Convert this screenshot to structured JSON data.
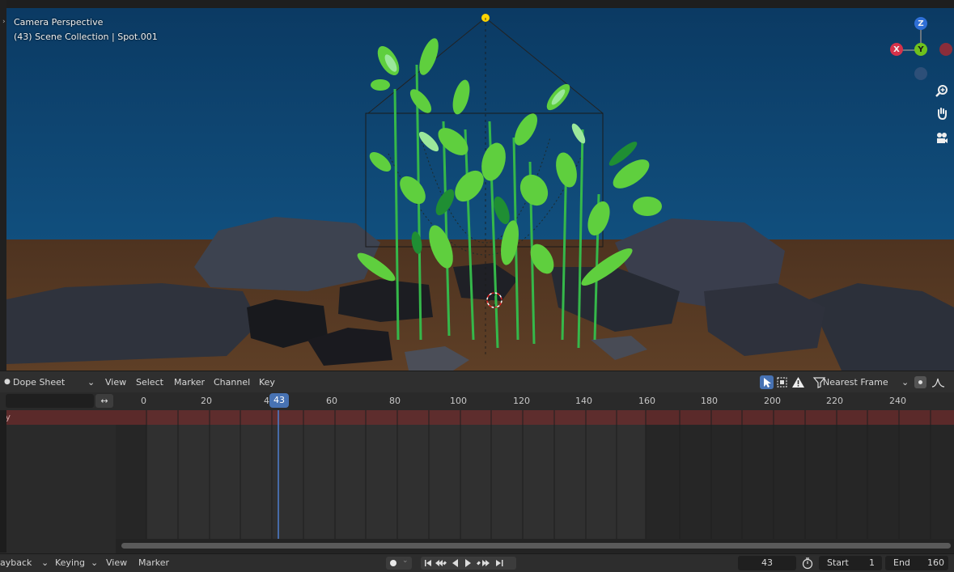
{
  "viewport": {
    "view_name": "Camera Perspective",
    "collection_info": "(43) Scene Collection | Spot.001",
    "gizmo_axes": {
      "z": "Z",
      "y": "Y",
      "x": "X"
    },
    "gizmo_icons": [
      "zoom-icon",
      "hand-pan-icon",
      "camera-view-icon"
    ]
  },
  "dope_sheet": {
    "editor_label": "Dope Sheet",
    "menus": [
      "View",
      "Select",
      "Marker",
      "Channel",
      "Key"
    ],
    "snapping_label": "Nearest Frame",
    "search_placeholder": "",
    "channel_row_label": "ry",
    "ruler_ticks": [
      "0",
      "20",
      "4",
      "60",
      "80",
      "100",
      "120",
      "140",
      "160",
      "180",
      "200",
      "220",
      "240"
    ],
    "current_frame_badge": "43"
  },
  "timeline": {
    "menus": [
      "ayback",
      "Keying",
      "View",
      "Marker"
    ],
    "current_frame": "43",
    "start_label": "Start",
    "start_value": "1",
    "end_label": "End",
    "end_value": "160"
  },
  "colors": {
    "accent": "#4772b3",
    "sky": "#0d3f6a",
    "ground": "#5a3a22",
    "leaf": "#55c93a",
    "channel_row": "#5b2a2a"
  }
}
